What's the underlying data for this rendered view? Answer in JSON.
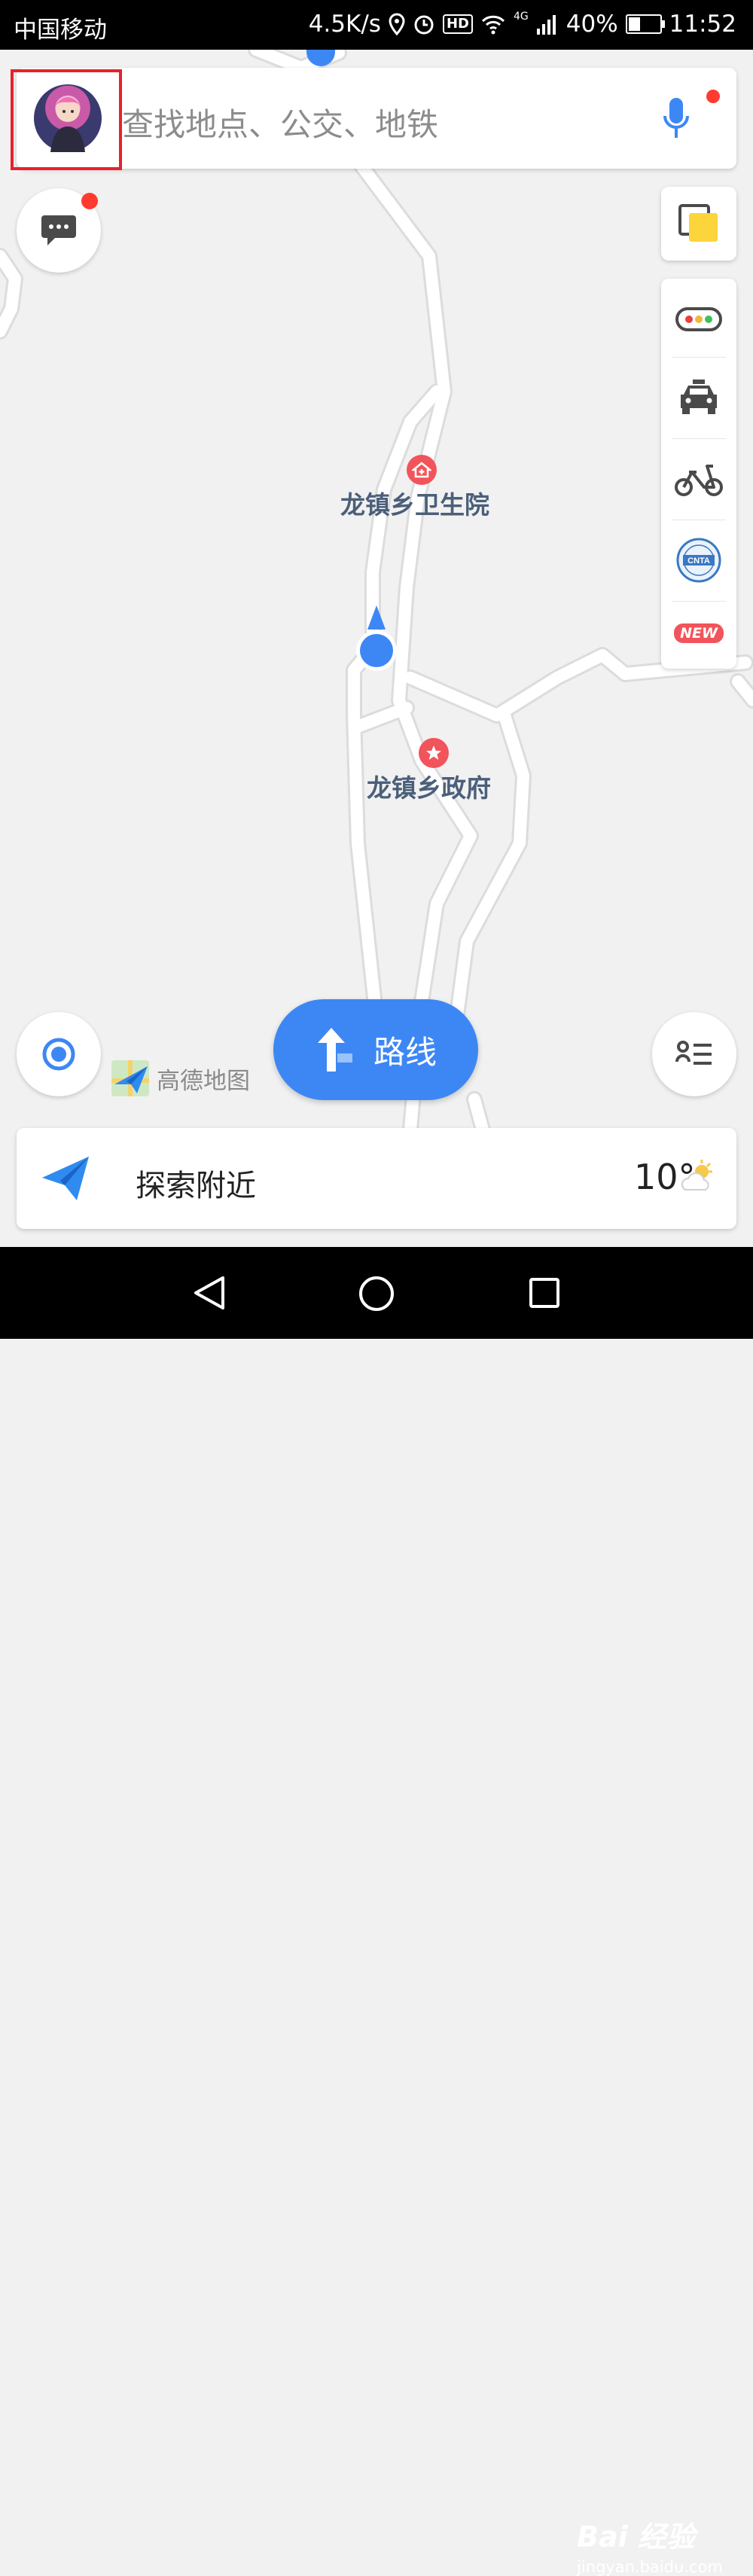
{
  "status_bar": {
    "carrier": "中国移动",
    "network_speed": "4.5K/s",
    "hd_badge": "HD",
    "network_type": "4G",
    "battery_percent": "40%",
    "battery_level": 0.4,
    "time": "11:52"
  },
  "search": {
    "placeholder": "查找地点、公交、地铁",
    "mic_icon": "microphone-icon",
    "has_notification_dot": true
  },
  "profile": {
    "avatar": "user-avatar-anime",
    "highlighted": true
  },
  "messages": {
    "icon": "chat-bubble-icon",
    "has_notification_dot": true
  },
  "map_layers": {
    "icon": "layers-icon"
  },
  "side_tools": [
    {
      "name": "traffic",
      "icon": "traffic-light-icon"
    },
    {
      "name": "taxi",
      "icon": "taxi-icon"
    },
    {
      "name": "bike",
      "icon": "bicycle-icon"
    },
    {
      "name": "tourism",
      "icon": "cnta-tourism-icon",
      "label": "CNTA"
    },
    {
      "name": "new",
      "icon": "new-badge-icon",
      "label": "NEW"
    }
  ],
  "map": {
    "pois": [
      {
        "label": "龙镇乡卫生院",
        "icon": "hospital-icon"
      },
      {
        "label": "龙镇乡政府",
        "icon": "government-star-icon"
      }
    ]
  },
  "controls": {
    "locate_icon": "locate-icon",
    "route_label": "路线",
    "route_icon": "route-arrow-icon",
    "list_icon": "list-icon"
  },
  "brand": {
    "logo_text": "高德地图",
    "icon": "amap-logo-icon"
  },
  "bottom_card": {
    "explore_label": "探索附近",
    "explore_icon": "paper-plane-icon",
    "temperature": "10°",
    "weather_icon": "partly-cloudy-sun-icon"
  },
  "nav_bar": {
    "back": "back-triangle-icon",
    "home": "home-circle-icon",
    "recents": "recents-square-icon"
  },
  "watermark": {
    "main": "Bai 经验",
    "sub": "jingyan.baidu.com"
  },
  "colors": {
    "accent": "#3d87f5",
    "poi_red": "#f2545b",
    "notification": "#ff3b30",
    "road": "#ffffff",
    "map_bg": "#f1f1f1"
  }
}
